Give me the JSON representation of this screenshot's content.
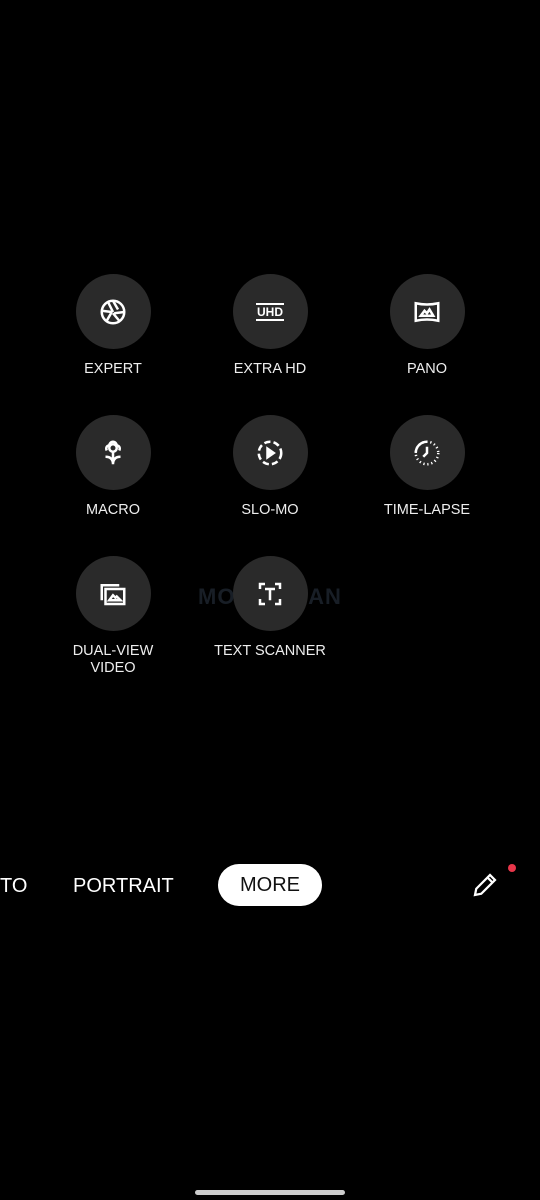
{
  "modes": [
    {
      "label": "EXPERT",
      "icon": "aperture-icon"
    },
    {
      "label": "EXTRA HD",
      "icon": "uhd-icon",
      "icon_text": "UHD"
    },
    {
      "label": "PANO",
      "icon": "panorama-icon"
    },
    {
      "label": "MACRO",
      "icon": "flower-icon"
    },
    {
      "label": "SLO-MO",
      "icon": "slow-motion-icon"
    },
    {
      "label": "TIME-LAPSE",
      "icon": "timelapse-icon"
    },
    {
      "label": "DUAL-VIEW\nVIDEO",
      "icon": "dual-view-icon"
    },
    {
      "label": "TEXT SCANNER",
      "icon": "text-scanner-icon"
    }
  ],
  "mode_bar": {
    "items": [
      "TO",
      "PORTRAIT"
    ],
    "selected": "MORE",
    "edit_icon": "pencil-icon",
    "notification_color": "#e8364a"
  },
  "watermark": "MOBIGYAAN"
}
